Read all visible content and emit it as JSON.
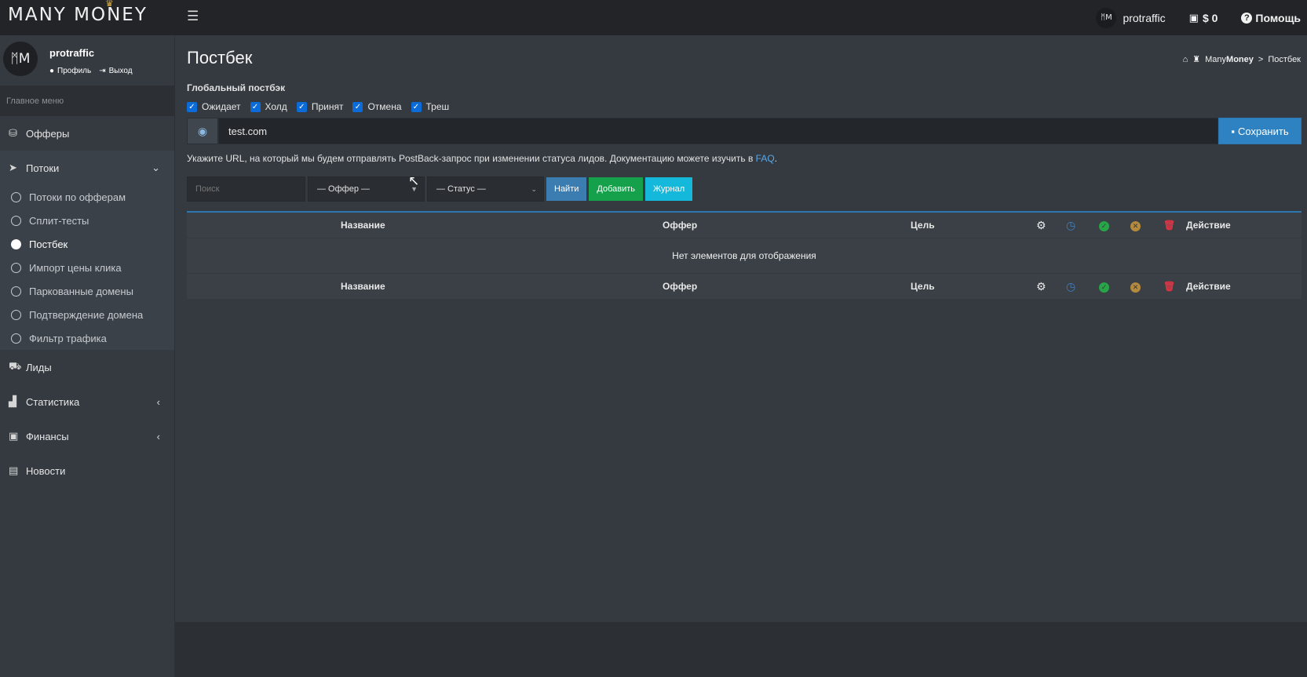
{
  "topbar": {
    "brand": "MANY MONEY",
    "user_name": "protraffic",
    "avatar_initials": "ᛗM",
    "balance": "$ 0",
    "help": "Помощь"
  },
  "sidebar": {
    "user": {
      "name": "protraffic",
      "profile_link": "Профиль",
      "logout_link": "Выход",
      "avatar_initials": "ᛗM"
    },
    "menu_header": "Главное меню",
    "items": [
      {
        "label": "Офферы",
        "icon": "basket-icon"
      },
      {
        "label": "Потоки",
        "icon": "paper-plane-icon"
      },
      {
        "label": "Лиды",
        "icon": "cart-icon"
      },
      {
        "label": "Статистика",
        "icon": "chart-area-icon"
      },
      {
        "label": "Финансы",
        "icon": "money-bill-icon"
      },
      {
        "label": "Новости",
        "icon": "newspaper-icon"
      }
    ],
    "sub_items": [
      "Потоки по офферам",
      "Сплит-тесты",
      "Постбек",
      "Импорт цены клика",
      "Паркованные домены",
      "Подтверждение домена",
      "Фильтр трафика"
    ],
    "active_sub": "Постбек"
  },
  "page": {
    "title": "Постбек",
    "breadcrumb": {
      "home_icon": "home-icon",
      "brand_prefix": "Many",
      "brand_bold": "Money",
      "separator": ">",
      "current": "Постбек"
    }
  },
  "global_postback": {
    "label": "Глобальный постбэк",
    "statuses": [
      {
        "label": "Ожидает",
        "checked": true
      },
      {
        "label": "Холд",
        "checked": true
      },
      {
        "label": "Принят",
        "checked": true
      },
      {
        "label": "Отмена",
        "checked": true
      },
      {
        "label": "Треш",
        "checked": true
      }
    ],
    "url_value": "test.com",
    "save_label": "Сохранить",
    "hint_text": "Укажите URL, на который мы будем отправлять PostBack-запрос при изменении статуса лидов. Документацию можете изучить в ",
    "hint_link": "FAQ",
    "hint_end": "."
  },
  "filters": {
    "search_placeholder": "Поиск",
    "offer_select": "— Оффер —",
    "status_select": "— Статус —",
    "find_label": "Найти",
    "add_label": "Добавить",
    "log_label": "Журнал"
  },
  "table": {
    "columns": {
      "name": "Название",
      "offer": "Оффер",
      "goal": "Цель",
      "action": "Действие"
    },
    "empty_text": "Нет элементов для отображения"
  },
  "colors": {
    "primary": "#2f82c2",
    "success": "#15a04b",
    "info": "#14b8db",
    "danger": "#dc3545",
    "checkbox": "#0b6bd8"
  }
}
